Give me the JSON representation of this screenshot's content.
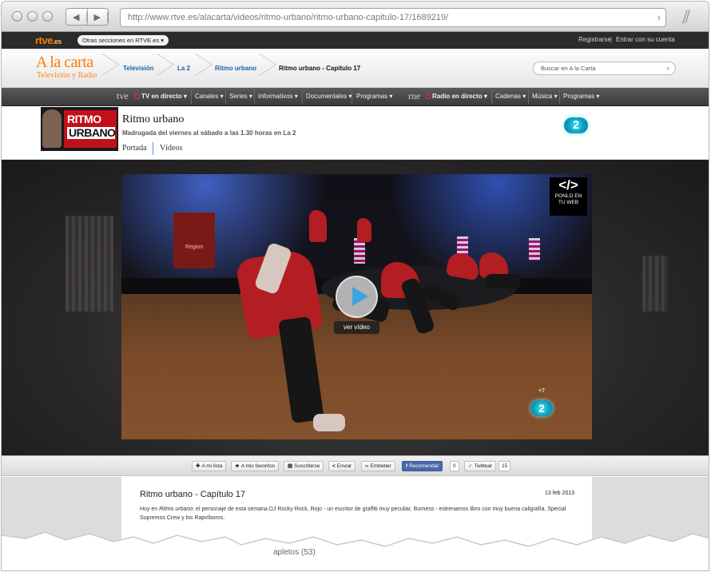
{
  "browser": {
    "url": "http://www.rtve.es/alacarta/videos/ritmo-urbano/ritmo-urbano-capitulo-17/1689219/",
    "back_icon": "chevron-left-icon",
    "forward_icon": "chevron-right-icon",
    "go_icon": "chevron-right-icon"
  },
  "topbar": {
    "logo": "rtve",
    "logo_suffix": ".es",
    "otras": "Otras secciones en RTVE.es",
    "register": "Registrarse",
    "login": "Entrar con su cuenta"
  },
  "header": {
    "logo_title": "A la carta",
    "logo_subtitle": "Televisión y Radio",
    "breadcrumb": [
      "Televisión",
      "La 2",
      "Ritmo urbano",
      "Ritmo urbano - Capítulo 17"
    ],
    "search_placeholder": "Buscar en A la Carta"
  },
  "nav": {
    "tve": "tve",
    "tv_directo": "TV en directo",
    "canales": "Canales",
    "series": "Series",
    "informativos": "Informativos",
    "documentales": "Documentales",
    "programas": "Programas",
    "rne": "rne",
    "radio_directo": "Radio en directo",
    "cadenas": "Cadenas",
    "musica": "Música",
    "programas2": "Programas"
  },
  "program": {
    "thumb_line1": "RITMO",
    "thumb_line2": "URBANO",
    "title": "Ritmo urbano",
    "schedule": "Madrugada del viernes al sábado a las 1.30 horas en La 2",
    "tab_portada": "Portada",
    "tab_videos": "Vídeos",
    "channel_badge": "2"
  },
  "player": {
    "sign_text": "Region",
    "ver_video": "ver vídeo",
    "ponlo_code": "</>",
    "ponlo_line1": "PONLO EN",
    "ponlo_line2": "TU WEB",
    "watermark": "2",
    "watermark_small": "+7"
  },
  "share": {
    "mi_lista": "A mi lista",
    "favoritos": "A mis favoritos",
    "suscribirse": "Suscribirse",
    "enviar": "Enviar",
    "embeber": "Embeber",
    "recomendar": "Recomendar",
    "recomendar_count": "0",
    "twittear": "Twittear",
    "twittear_count": "15"
  },
  "episode": {
    "title": "Ritmo urbano - Capítulo 17",
    "date": "13 feb 2013",
    "desc_prefix": "Hoy en ",
    "desc_program": "Ritmo urbano",
    "desc_rest": ": el personaje de esta semana DJ Rocky Rock, Rojo - un escritor de graffiti muy peculiar, Burness - estrenamos libro con muy buena caligrafía, Special Supremos Crew y los Rapvíboros."
  },
  "below": {
    "completos": "apletos (53)"
  }
}
